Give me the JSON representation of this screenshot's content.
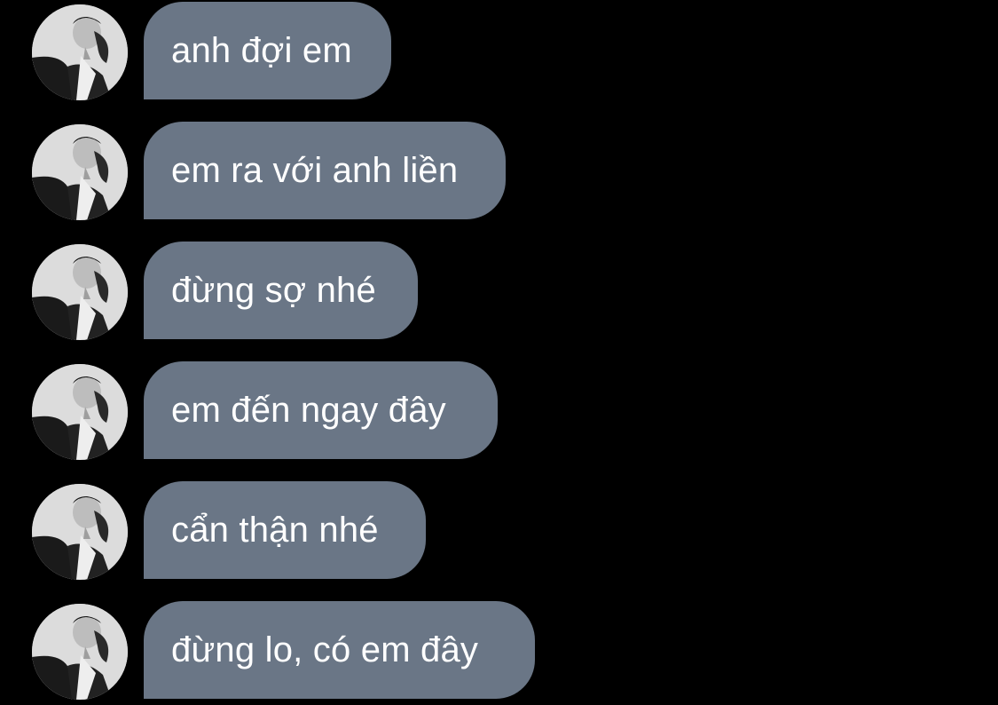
{
  "theme": {
    "background": "#000000",
    "bubble_color": "#6a7686",
    "text_color": "#ffffff"
  },
  "avatar": {
    "icon": "profile-photo-grayscale-man"
  },
  "messages": [
    {
      "text": "anh đợi em"
    },
    {
      "text": "em ra với anh liền"
    },
    {
      "text": "đừng sợ nhé"
    },
    {
      "text": "em đến ngay đây"
    },
    {
      "text": "cẩn thận nhé"
    },
    {
      "text": "đừng lo, có em đây"
    }
  ]
}
